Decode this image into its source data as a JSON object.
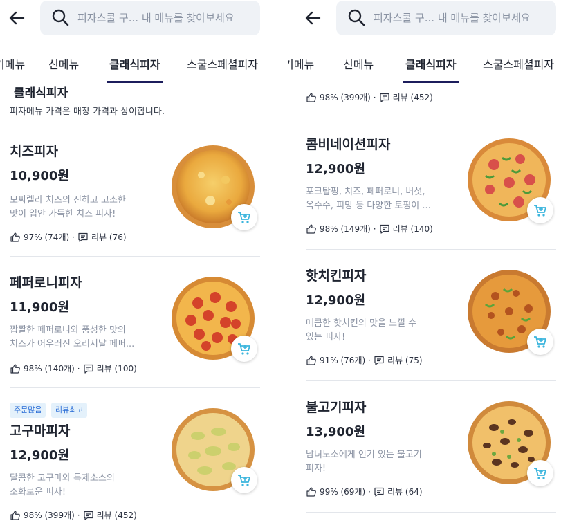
{
  "left": {
    "search_placeholder": "피자스쿨 구... 내 메뉴를 찾아보세요",
    "tabs": [
      "기메뉴",
      "신메뉴",
      "클래식피자",
      "스쿨스페셜피자"
    ],
    "section_title": "클래식피자",
    "section_note": "피자메뉴 가격은 매장 가격과 상이합니다.",
    "items": [
      {
        "name": "치즈피자",
        "price": "10,900원",
        "desc1": "모짜렐라 치즈의 진하고 고소한",
        "desc2": "맛이 입안 가득한 치즈 피자!",
        "like": "97% (74개)",
        "review": "리뷰 (76)",
        "pizza": "cheese"
      },
      {
        "name": "페퍼로니피자",
        "price": "11,900원",
        "desc1": "짭짤한 페퍼로니와 풍성한 맛의",
        "desc2": "치즈가 어우러진 오리지날 페퍼...",
        "like": "98% (140개)",
        "review": "리뷰 (100)",
        "pizza": "pepperoni"
      },
      {
        "name": "고구마피자",
        "price": "12,900원",
        "desc1": "달콤한 고구마와 특제소스의",
        "desc2": "조화로운 피자!",
        "like": "98% (399개)",
        "review": "리뷰 (452)",
        "pizza": "sweetpotato",
        "badges": [
          "주문많음",
          "리뷰최고"
        ]
      }
    ]
  },
  "right": {
    "search_placeholder": "피자스쿨 구... 내 메뉴를 찾아보세요",
    "tabs": [
      "기메뉴",
      "신메뉴",
      "클래식피자",
      "스쿨스페셜피자"
    ],
    "top_meta": {
      "like": "98% (399개)",
      "review": "리뷰 (452)"
    },
    "items": [
      {
        "name": "콤비네이션피자",
        "price": "12,900원",
        "desc1": "포크탑핑, 치즈, 페퍼로니, 버섯,",
        "desc2": "옥수수, 피망 등 다양한 토핑이 ...",
        "like": "98% (149개)",
        "review": "리뷰 (140)",
        "pizza": "combination"
      },
      {
        "name": "핫치킨피자",
        "price": "12,900원",
        "desc1": "매콤한 핫치킨의 맛을 느낄 수",
        "desc2": "있는 피자!",
        "like": "91% (76개)",
        "review": "리뷰 (75)",
        "pizza": "hotchicken"
      },
      {
        "name": "불고기피자",
        "price": "13,900원",
        "desc1": "남녀노소에게 인기 있는 불고기",
        "desc2": "피자!",
        "like": "99% (69개)",
        "review": "리뷰 (64)",
        "pizza": "bulgogi"
      }
    ]
  },
  "icons": {
    "back": "back-arrow-icon",
    "search": "search-icon",
    "like": "thumbs-up-icon",
    "review": "review-icon",
    "cart": "add-to-cart-icon"
  },
  "colors": {
    "accent": "#1c1d5c",
    "cart": "#3bb5dd",
    "badge_text": "#2a6dd6",
    "badge_bg": "#e4f1fb",
    "desc": "#8b93a3"
  }
}
